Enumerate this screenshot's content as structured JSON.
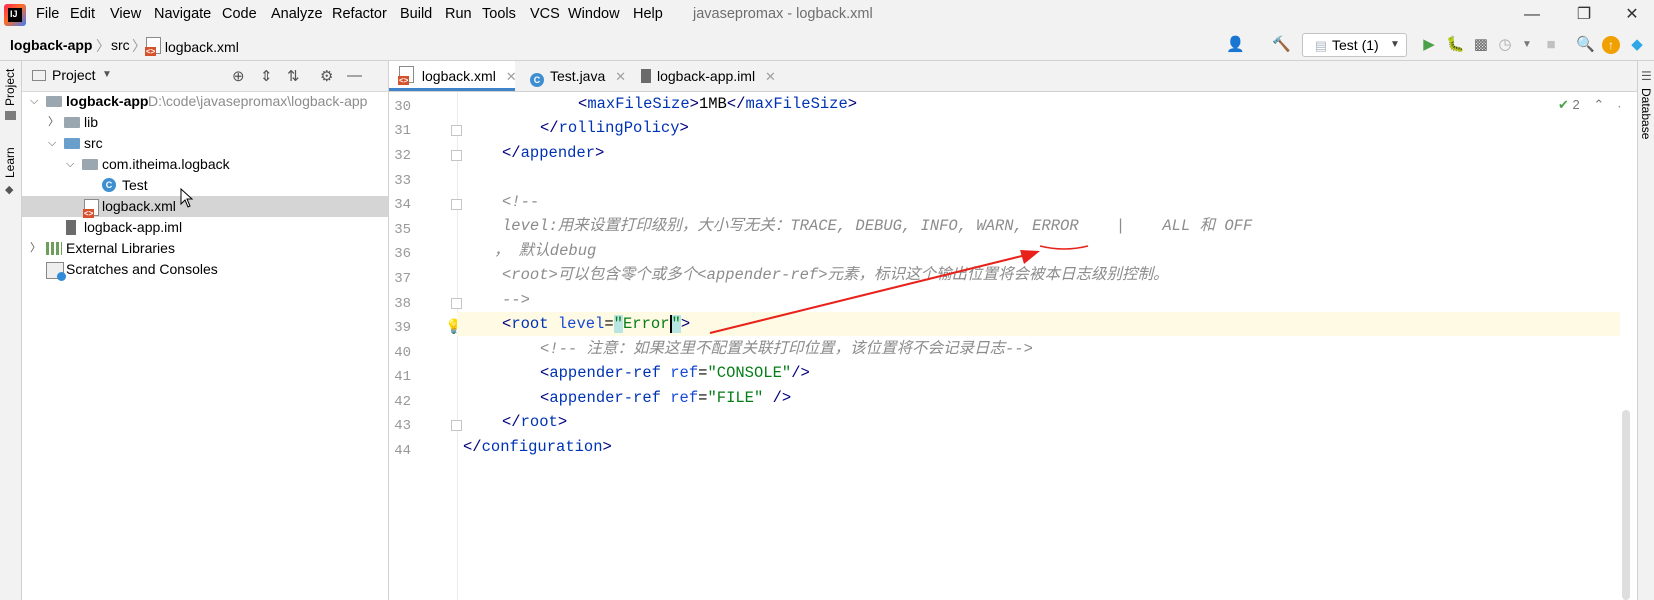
{
  "window": {
    "title": "javasepromax - logback.xml"
  },
  "menu": [
    "File",
    "Edit",
    "View",
    "Navigate",
    "Code",
    "Analyze",
    "Refactor",
    "Build",
    "Run",
    "Tools",
    "VCS",
    "Window",
    "Help"
  ],
  "breadcrumb": {
    "project": "logback-app",
    "folder": "src",
    "file": "logback.xml"
  },
  "toolbar": {
    "run_config": "Test (1)"
  },
  "left_strip": {
    "project_label": "Project",
    "learn_label": "Learn"
  },
  "right_strip": {
    "database_label": "Database"
  },
  "project_panel": {
    "title": "Project",
    "tree": [
      {
        "label": "logback-app",
        "path": "D:\\code\\javasepromax\\logback-app"
      },
      {
        "label": "lib"
      },
      {
        "label": "src"
      },
      {
        "label": "com.itheima.logback"
      },
      {
        "label": "Test"
      },
      {
        "label": "logback.xml"
      },
      {
        "label": "logback-app.iml"
      },
      {
        "label": "External Libraries"
      },
      {
        "label": "Scratches and Consoles"
      }
    ]
  },
  "editor": {
    "tabs": [
      {
        "label": "logback.xml"
      },
      {
        "label": "Test.java"
      },
      {
        "label": "logback-app.iml"
      }
    ],
    "inspection_count": "2",
    "line_numbers": [
      "30",
      "31",
      "32",
      "33",
      "34",
      "35",
      "36",
      "37",
      "38",
      "39",
      "40",
      "41",
      "42",
      "43",
      "44"
    ],
    "lines": {
      "l30_open": "<",
      "l30_tag": "maxFileSize",
      "l30_close": ">",
      "l30_text": "1MB",
      "l30_end_open": "</",
      "l30_end_tag": "maxFileSize",
      "l30_end_close": ">",
      "l31_open": "</",
      "l31_tag": "rollingPolicy",
      "l31_close": ">",
      "l32_open": "</",
      "l32_tag": "appender",
      "l32_close": ">",
      "l34": "<!--",
      "l35": "level:用来设置打印级别，大小写无关：TRACE, DEBUG, INFO, WARN, ERROR    |    ALL 和 OFF",
      "l36": "， 默认debug",
      "l37": "<root>可以包含零个或多个<appender-ref>元素，标识这个输出位置将会被本日志级别控制。",
      "l38": "-->",
      "l39_open": "<",
      "l39_tag": "root",
      "l39_attr": "level",
      "l39_eq": "=",
      "l39_q1": "\"",
      "l39_val": "Error",
      "l39_q2": "\"",
      "l39_close": ">",
      "l40": "<!-- 注意：如果这里不配置关联打印位置，该位置将不会记录日志-->",
      "l41_open": "<",
      "l41_tag": "appender-ref",
      "l41_attr": "ref",
      "l41_eq": "=",
      "l41_val": "\"CONSOLE\"",
      "l41_close": "/>",
      "l42_open": "<",
      "l42_tag": "appender-ref",
      "l42_attr": "ref",
      "l42_eq": "=",
      "l42_val": "\"FILE\"",
      "l42_close": " />",
      "l43_open": "</",
      "l43_tag": "root",
      "l43_close": ">",
      "l44_open": "</",
      "l44_tag": "configuration",
      "l44_close": ">"
    }
  },
  "colors": {
    "accent": "#4083c9",
    "annotation": "#e8221b"
  }
}
